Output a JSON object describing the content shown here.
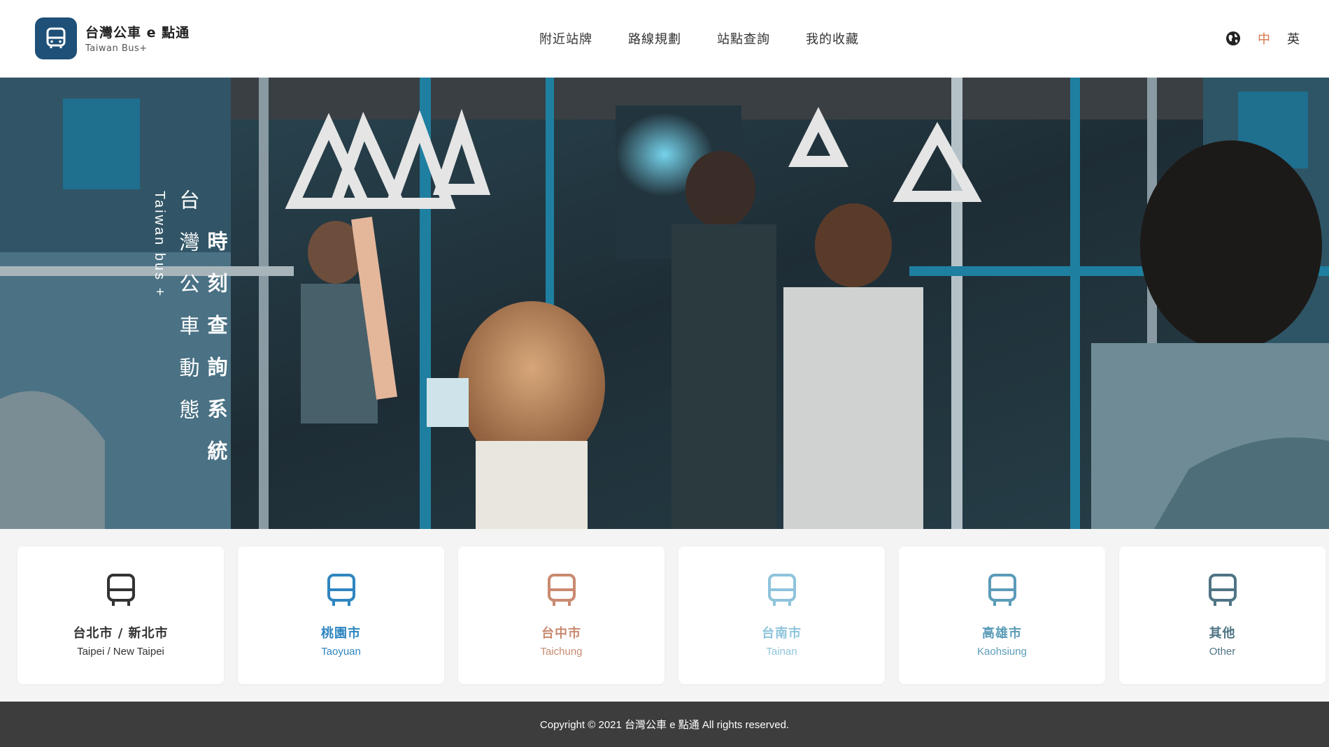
{
  "brand": {
    "title": "台灣公車 e 點通",
    "subtitle": "Taiwan Bus+",
    "logo_icon": "bus-icon",
    "logo_color": "#1e5078"
  },
  "nav": {
    "items": [
      {
        "label": "附近站牌"
      },
      {
        "label": "路線規劃"
      },
      {
        "label": "站點查詢"
      },
      {
        "label": "我的收藏"
      }
    ]
  },
  "language": {
    "icon": "globe-icon",
    "zh": "中",
    "en": "英",
    "active_color": "#d9784a"
  },
  "hero": {
    "english": "Taiwan bus +",
    "line1": "台灣公車動態",
    "line2": "時刻查詢系統"
  },
  "cities": [
    {
      "name_zh": "台北市 / 新北市",
      "name_en": "Taipei / New Taipei",
      "color": "#333333",
      "icon": "bus-icon"
    },
    {
      "name_zh": "桃園市",
      "name_en": "Taoyuan",
      "color": "#2f86c0",
      "icon": "bus-icon"
    },
    {
      "name_zh": "台中市",
      "name_en": "Taichung",
      "color": "#c98a70",
      "icon": "bus-icon"
    },
    {
      "name_zh": "台南市",
      "name_en": "Tainan",
      "color": "#8ec4dc",
      "icon": "bus-icon"
    },
    {
      "name_zh": "高雄市",
      "name_en": "Kaohsiung",
      "color": "#5b9cb8",
      "icon": "bus-icon"
    },
    {
      "name_zh": "其他",
      "name_en": "Other",
      "color": "#4f7484",
      "icon": "bus-icon"
    }
  ],
  "footer": {
    "copyright": "Copyright © 2021 台灣公車 e 點通 All rights reserved."
  }
}
